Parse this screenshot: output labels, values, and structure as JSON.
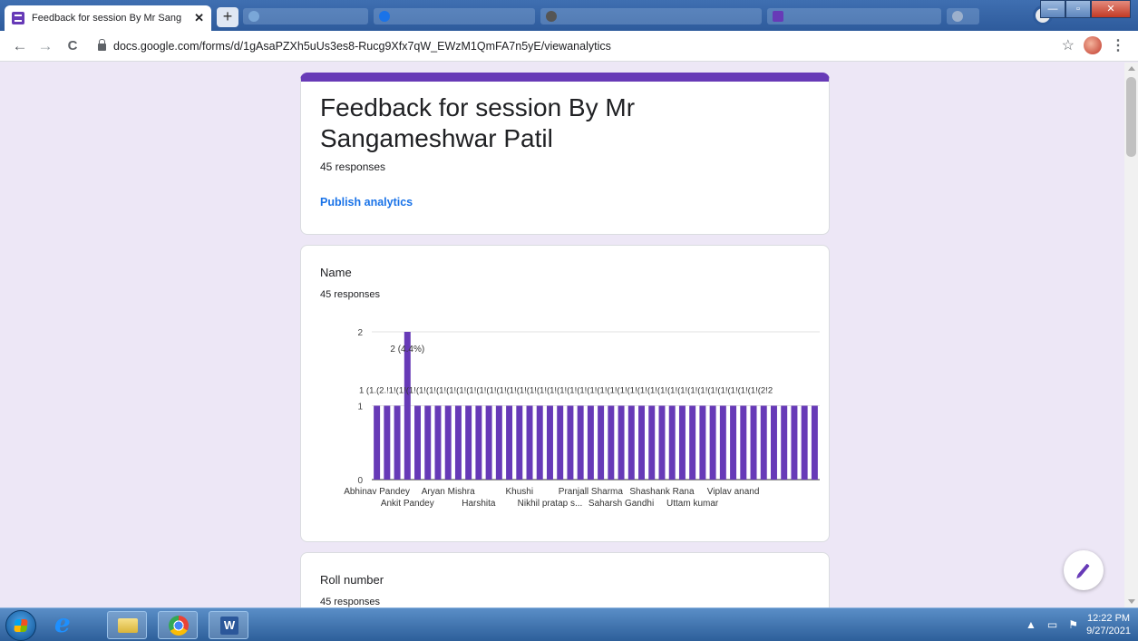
{
  "browser": {
    "tab_title": "Feedback for session By Mr Sang",
    "tab_close": "✕",
    "new_tab": "+",
    "url": "docs.google.com/forms/d/1gAsaPZXh5uUs3es8-Rucg9Xfx7qW_EWzM1QmFA7n5yE/viewanalytics"
  },
  "form": {
    "title": "Feedback for session By Mr Sangameshwar Patil",
    "response_count": "45 responses",
    "publish_label": "Publish analytics"
  },
  "questions": [
    {
      "title": "Name",
      "response_count": "45 responses"
    },
    {
      "title": "Roll number",
      "response_count": "45 responses"
    }
  ],
  "taskbar": {
    "time": "12:22 PM",
    "date": "9/27/2021"
  },
  "colors": {
    "accent": "#673ab7",
    "background": "#ede7f6",
    "link": "#1a73e8"
  },
  "chart_data": {
    "type": "bar",
    "title": "",
    "xlabel": "",
    "ylabel": "",
    "ylim": [
      0,
      2
    ],
    "yticks": [
      0,
      1,
      2
    ],
    "bar_count": 44,
    "values": [
      1,
      1,
      1,
      2,
      1,
      1,
      1,
      1,
      1,
      1,
      1,
      1,
      1,
      1,
      1,
      1,
      1,
      1,
      1,
      1,
      1,
      1,
      1,
      1,
      1,
      1,
      1,
      1,
      1,
      1,
      1,
      1,
      1,
      1,
      1,
      1,
      1,
      1,
      1,
      1,
      1,
      1,
      1,
      1
    ],
    "highlight_label": "2 (4.4%)",
    "value_label_row": "1 (1.(2.!1!(1!(1!(1!(1!(1!(1!(1!(1!(1!(1!(1!(1!(1!(1!(1!(1!(1!(1!(1!(1!(1!(1!(1!(1!(1!(1!(1!(1!(1!(1!(1!(1!(1!(1!(1!(1!(2!2",
    "x_labels_row1": [
      {
        "label": "Abhinav Pandey",
        "bar": 0
      },
      {
        "label": "Aryan Mishra",
        "bar": 7
      },
      {
        "label": "Khushi",
        "bar": 14
      },
      {
        "label": "Pranjall Sharma",
        "bar": 21
      },
      {
        "label": "Shashank Rana",
        "bar": 28
      },
      {
        "label": "Viplav anand",
        "bar": 35
      }
    ],
    "x_labels_row2": [
      {
        "label": "Ankit Pandey",
        "bar": 3
      },
      {
        "label": "Harshita",
        "bar": 10
      },
      {
        "label": "Nikhil pratap s...",
        "bar": 17
      },
      {
        "label": "Saharsh Gandhi",
        "bar": 24
      },
      {
        "label": "Uttam kumar",
        "bar": 31
      }
    ]
  }
}
